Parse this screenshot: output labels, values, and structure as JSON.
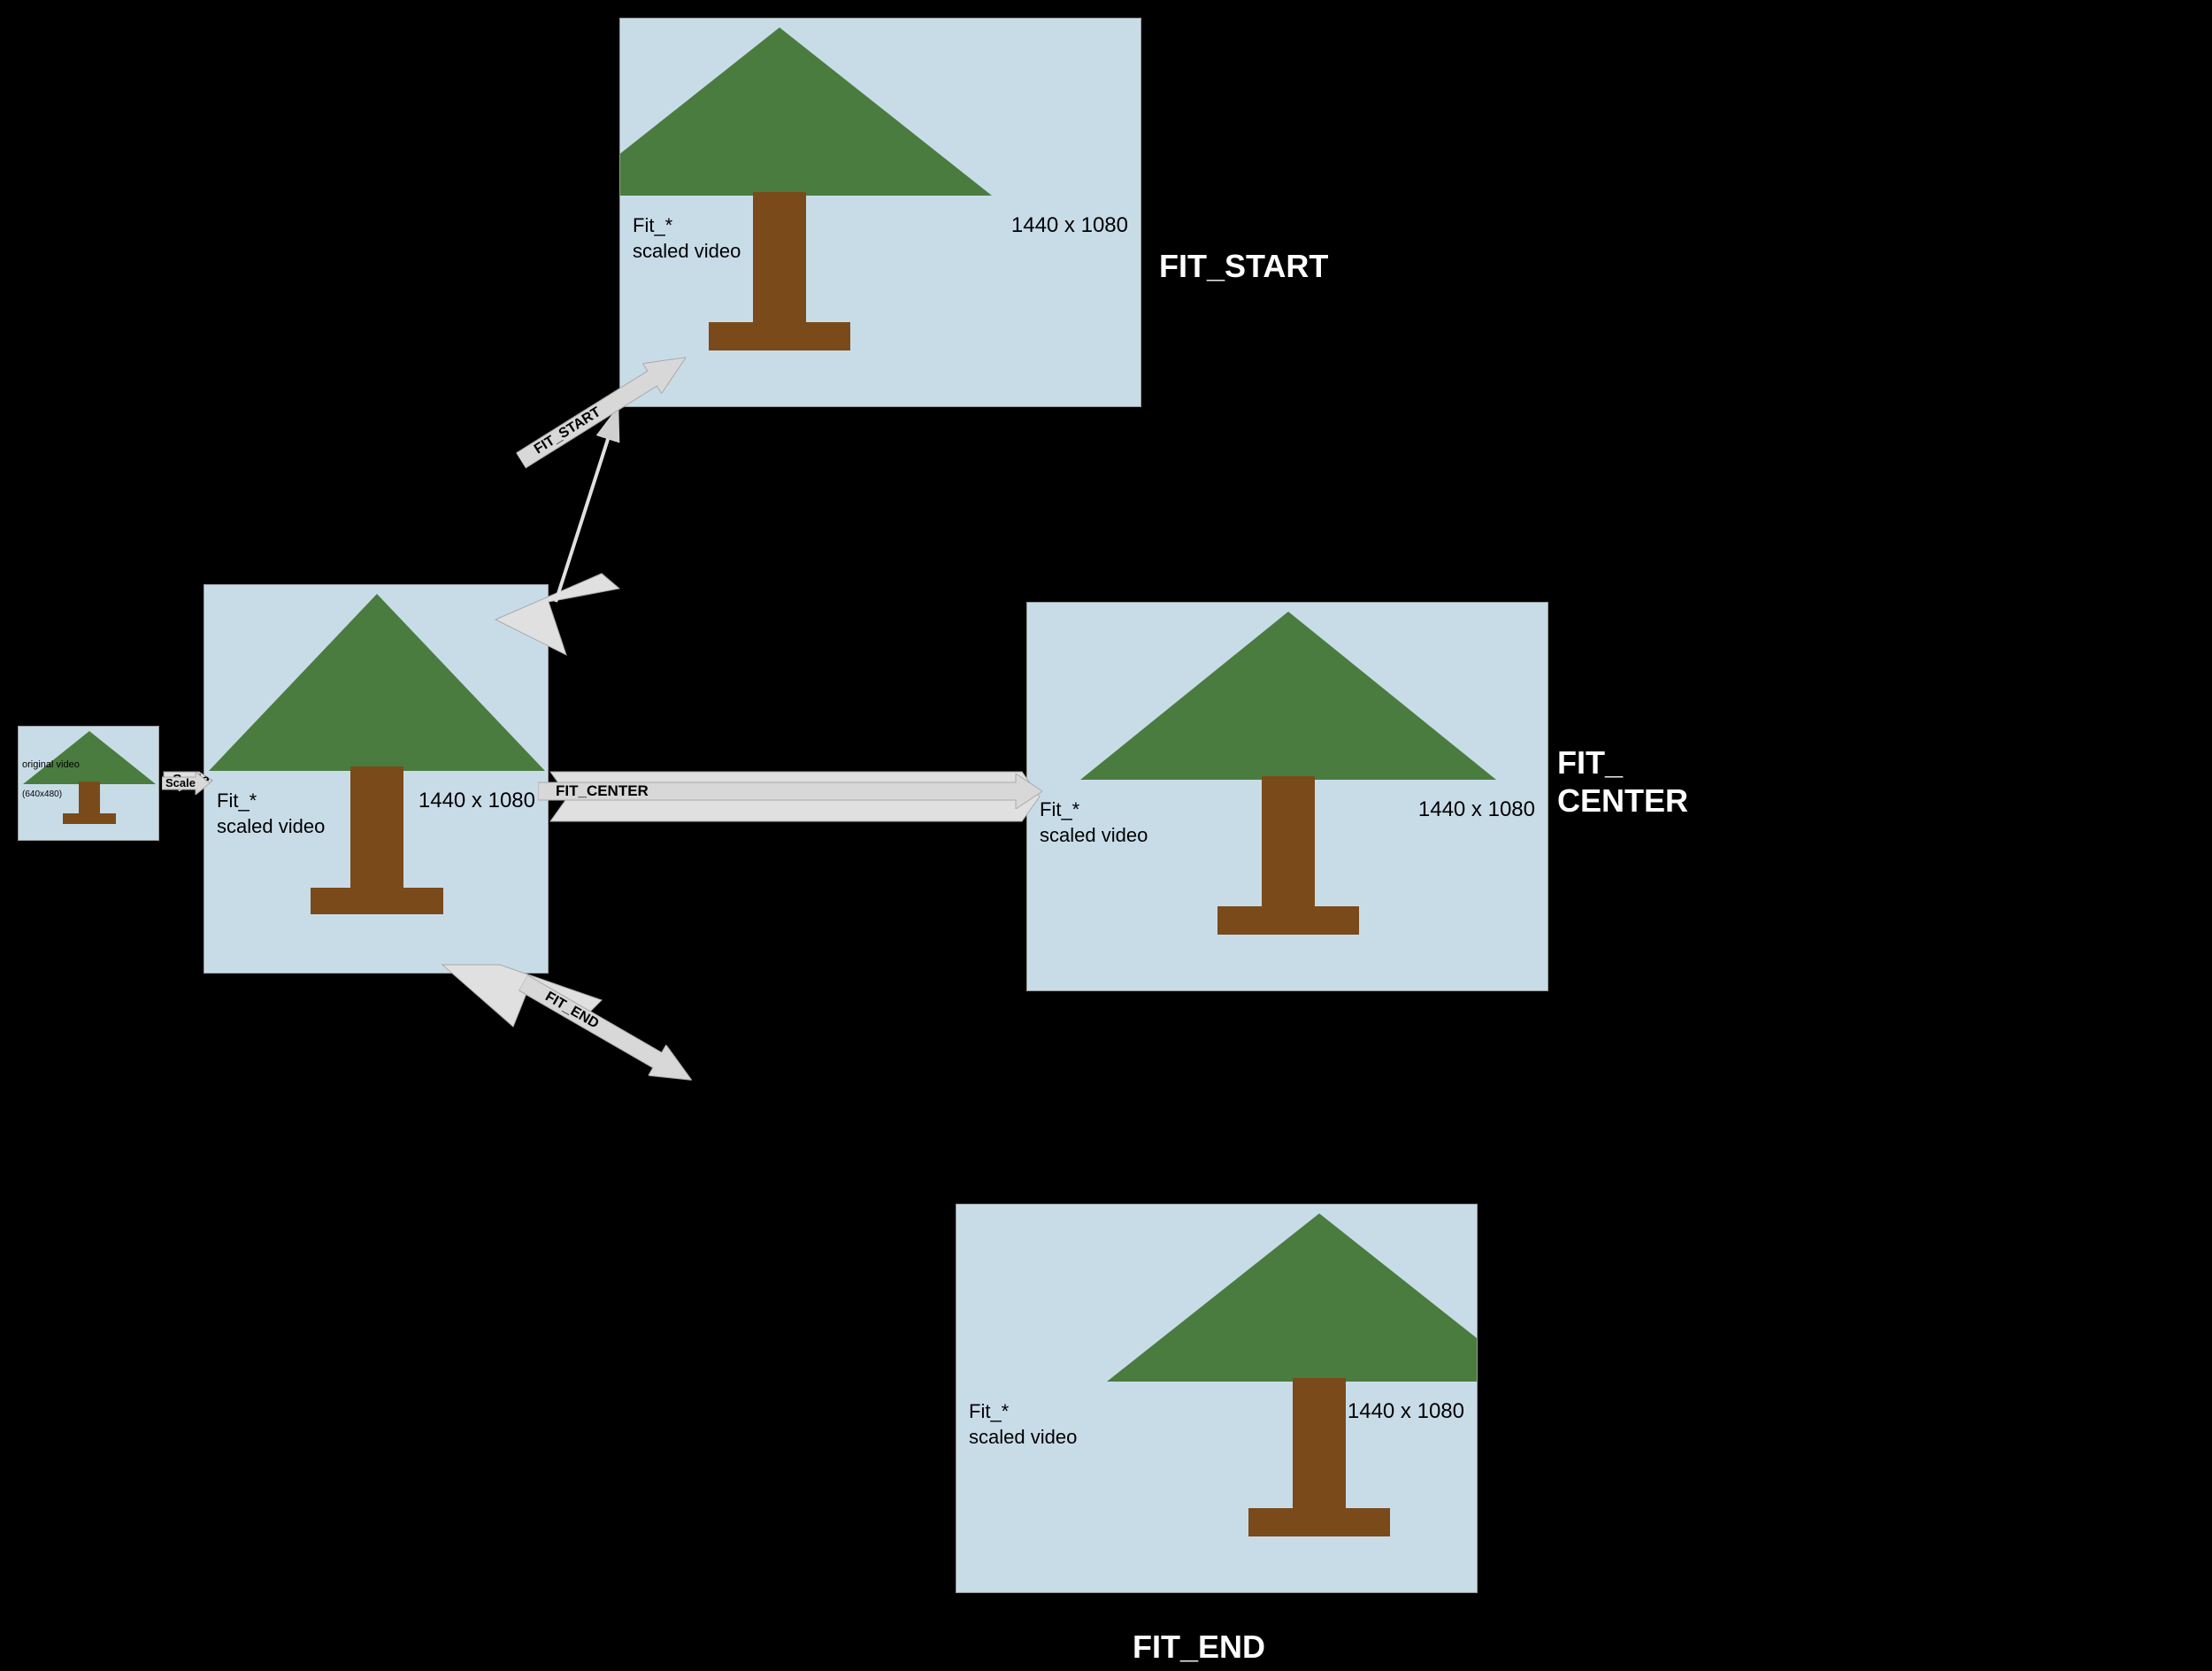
{
  "original_video": {
    "label": "original\nvideo",
    "dimensions": "(640x480)",
    "box_bg": "#c8dce8"
  },
  "scale_label": "Scale",
  "scaled_video": {
    "label": "Fit_*\nscaled video",
    "dimensions": "1440 x 1080"
  },
  "fit_start": {
    "label": "Fit_*\nscaled video",
    "dimensions": "1440 x 1080",
    "section_label": "FIT_START",
    "arrow_label": "FIT_START"
  },
  "fit_center": {
    "label": "Fit_*\nscaled video",
    "dimensions": "1440 x 1080",
    "section_label": "FIT_\nCENTER",
    "arrow_label": "FIT_CENTER"
  },
  "fit_end": {
    "label": "Fit_*\nscaled video",
    "dimensions": "1440 x 1080",
    "section_label": "FIT_END",
    "arrow_label": "FIT_END"
  },
  "colors": {
    "background": "#000000",
    "video_bg": "#c8dce8",
    "tree_top": "#4a7c3f",
    "tree_trunk": "#7a4a1a",
    "tree_base": "#7a4a1a",
    "arrow_fill": "#e0e0e0",
    "arrow_stroke": "#888888",
    "text_white": "#ffffff",
    "text_black": "#000000"
  }
}
